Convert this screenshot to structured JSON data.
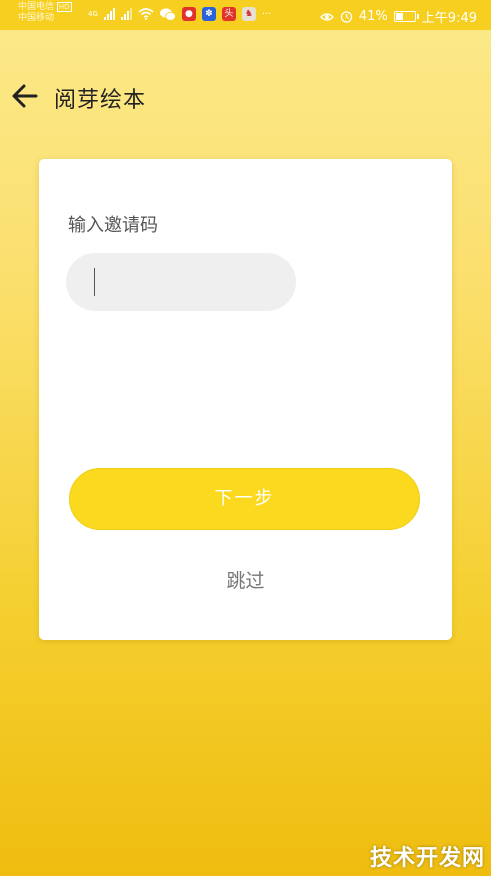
{
  "status_bar": {
    "carrier_1": "中国电信",
    "carrier_1_badge": "HD",
    "carrier_2": "中国移动",
    "network_1": "4G",
    "app_icons": [
      "weibo-icon",
      "baidu-icon",
      "toutiao-icon",
      "game-icon"
    ],
    "app_icon_colors": [
      "#e2332a",
      "#2a63d9",
      "#e2332a",
      "#e8e0d0"
    ],
    "toutiao_label": "头",
    "more": "···",
    "battery_percent": "41%",
    "battery_level": 0.41,
    "time": "上午9:49"
  },
  "header": {
    "title": "阅芽绘本"
  },
  "card": {
    "label": "输入邀请码",
    "input_value": "",
    "input_placeholder": "",
    "next_label": "下一步",
    "skip_label": "跳过"
  },
  "watermark": "技术开发网",
  "colors": {
    "accent": "#fad91e",
    "card": "#ffffff",
    "input_bg": "#efefef"
  }
}
